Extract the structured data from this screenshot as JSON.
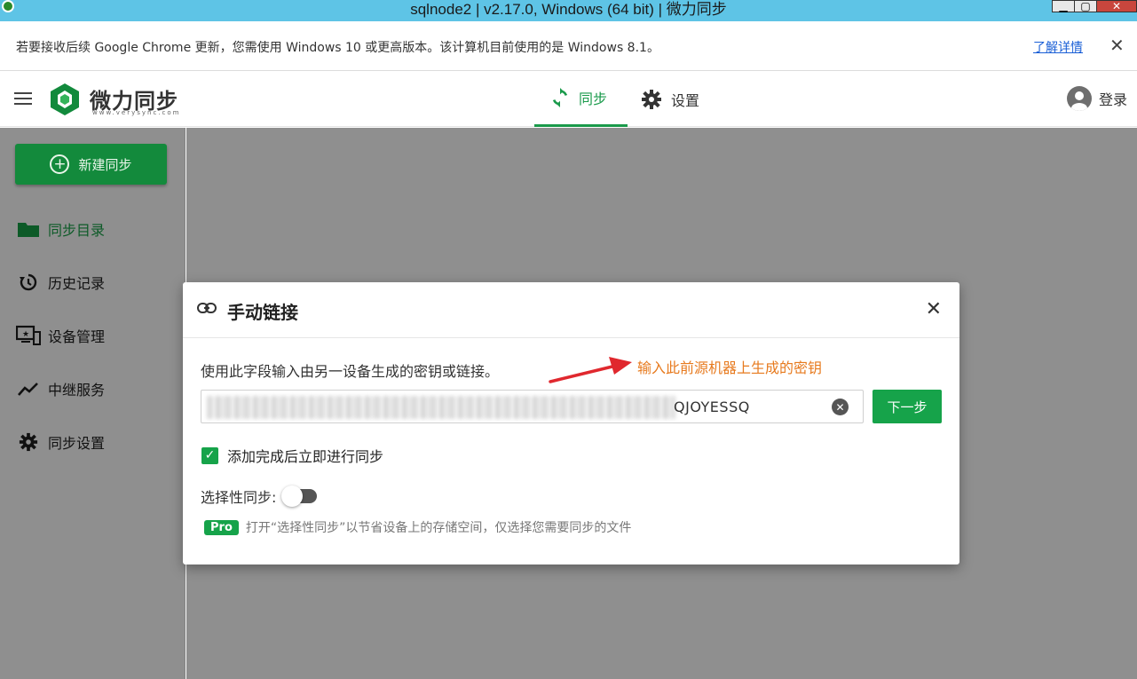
{
  "window": {
    "title": "sqlnode2 | v2.17.0, Windows (64 bit) | 微力同步",
    "minimize": "▁",
    "maximize": "▢",
    "close": "✕"
  },
  "notice": {
    "message": "若要接收后续 Google Chrome 更新，您需使用 Windows 10 或更高版本。该计算机目前使用的是 Windows 8.1。",
    "learn_more": "了解详情",
    "close": "✕"
  },
  "appbar": {
    "logo_text": "微力同步",
    "logo_sub": "www.verysync.com",
    "tabs": [
      {
        "label": "同步"
      },
      {
        "label": "设置"
      }
    ],
    "login": "登录"
  },
  "sidebar": {
    "new_button": "新建同步",
    "items": [
      {
        "label": "同步目录"
      },
      {
        "label": "历史记录"
      },
      {
        "label": "设备管理"
      },
      {
        "label": "中继服务"
      },
      {
        "label": "同步设置"
      }
    ]
  },
  "dialog": {
    "title": "手动链接",
    "close": "✕",
    "description": "使用此字段输入由另一设备生成的密钥或链接。",
    "annotation": "输入此前源机器上生成的密钥",
    "key_value_visible": "QJOYESSQ",
    "clear": "✕",
    "next_button": "下一步",
    "auto_sync_label": "添加完成后立即进行同步",
    "auto_sync_checked": true,
    "selective_label": "选择性同步:",
    "selective_enabled": false,
    "pro_badge": "Pro",
    "pro_text": "打开“选择性同步”以节省设备上的存储空间，仅选择您需要同步的文件"
  },
  "colors": {
    "accent": "#16a34a",
    "titlebar": "#5ec4e6",
    "annotation": "#e77a1e",
    "arrow": "#e0282e"
  }
}
